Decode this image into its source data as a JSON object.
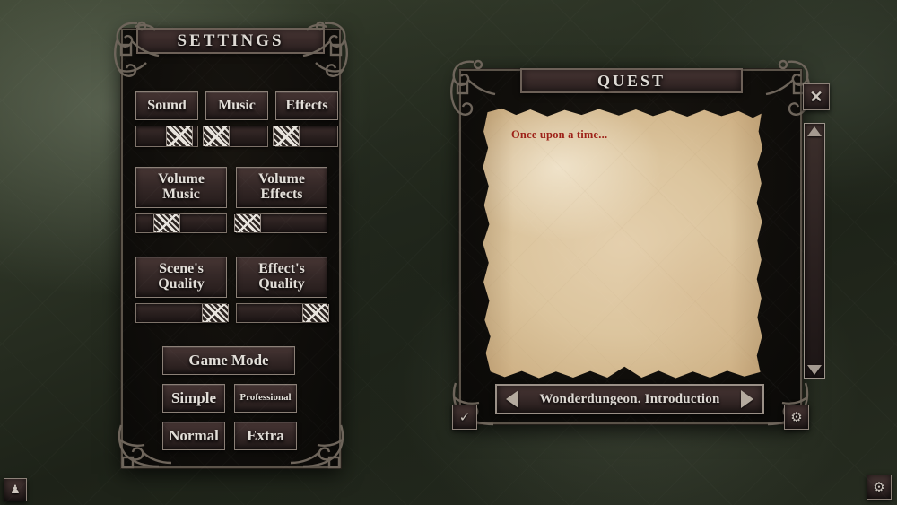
{
  "settings": {
    "title": "SETTINGS",
    "toggles": [
      {
        "label": "Sound",
        "slider_value": 70
      },
      {
        "label": "Music",
        "slider_value": 16
      },
      {
        "label": "Effects",
        "slider_value": 16
      }
    ],
    "volumes": [
      {
        "label": "Volume\nMusic",
        "slider_value": 34
      },
      {
        "label": "Volume\nEffects",
        "slider_value": 12
      }
    ],
    "quality": [
      {
        "label": "Scene's\nQuality",
        "slider_value": 88
      },
      {
        "label": "Effect's\nQuality",
        "slider_value": 88
      }
    ],
    "game_mode": {
      "header": "Game Mode",
      "options": [
        "Simple",
        "Professional",
        "Normal",
        "Extra"
      ]
    }
  },
  "quest": {
    "title": "QUEST",
    "body_text": "Once upon a time...",
    "nav": {
      "prev_icon": "left-triangle-icon",
      "label": "Wonderdungeon. Introduction",
      "next_icon": "right-triangle-icon"
    },
    "close_icon": "✕",
    "accept_icon": "✓",
    "options_icon": "⚙",
    "scrollbar": {
      "up_icon": "up-triangle-icon",
      "down_icon": "down-triangle-icon"
    }
  },
  "hud": {
    "character_icon": "♟",
    "settings_icon": "⚙"
  },
  "colors": {
    "frame_border": "#5b5349",
    "panel_dark": "#110f0c",
    "button_face": "#36292 8",
    "text_light": "#e2ded8",
    "quest_text_red": "#9d2118",
    "parchment": "#ddc7a2",
    "background_olive": "#2c3325"
  }
}
